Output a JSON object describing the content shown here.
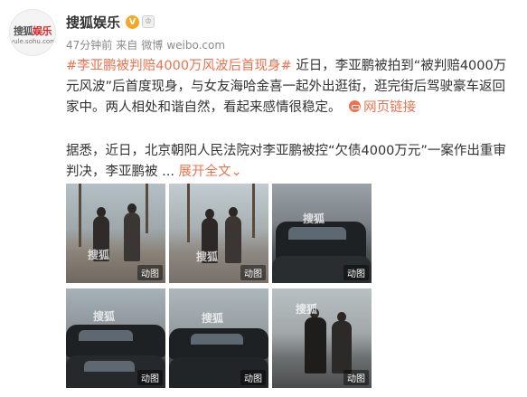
{
  "user": {
    "avatar_main_a": "搜狐",
    "avatar_main_b": "娱乐",
    "avatar_sub": "yule.sohu.com",
    "name": "搜狐娱乐",
    "verified_mark": "V",
    "member_mark": "♔"
  },
  "meta": {
    "time": "47分钟前",
    "source_prefix": "来自",
    "source": "微博",
    "domain": "weibo.com"
  },
  "post": {
    "topic": "#李亚鹏被判赔4000万风波后首现身#",
    "text_1": "近日，李亚鹏被拍到“被判赔4000万元风波”后首度现身，与女友海哈金喜一起外出逛街，逛完街后驾驶豪车返回家中。两人相处和谐自然，看起来感情很稳定。",
    "link_label": "网页链接",
    "text_2": "据悉，近日，北京朝阳人民法院对李亚鹏被控“欠债4000万元”一案作出重审判决，李亚鹏被 ...",
    "expand_label": "展开全文",
    "expand_arrow": "⌄"
  },
  "photos": [
    {
      "badge": "动图",
      "watermark": "搜狐"
    },
    {
      "badge": "动图",
      "watermark": "搜狐"
    },
    {
      "badge": "动图",
      "watermark": "搜狐"
    },
    {
      "badge": "动图",
      "watermark": "搜狐"
    },
    {
      "badge": "动图",
      "watermark": "搜狐"
    },
    {
      "badge": "动图",
      "watermark": "搜狐"
    }
  ],
  "colors": {
    "link": "#eb7350",
    "verified": "#f5a623",
    "brand_red": "#d6272a"
  }
}
